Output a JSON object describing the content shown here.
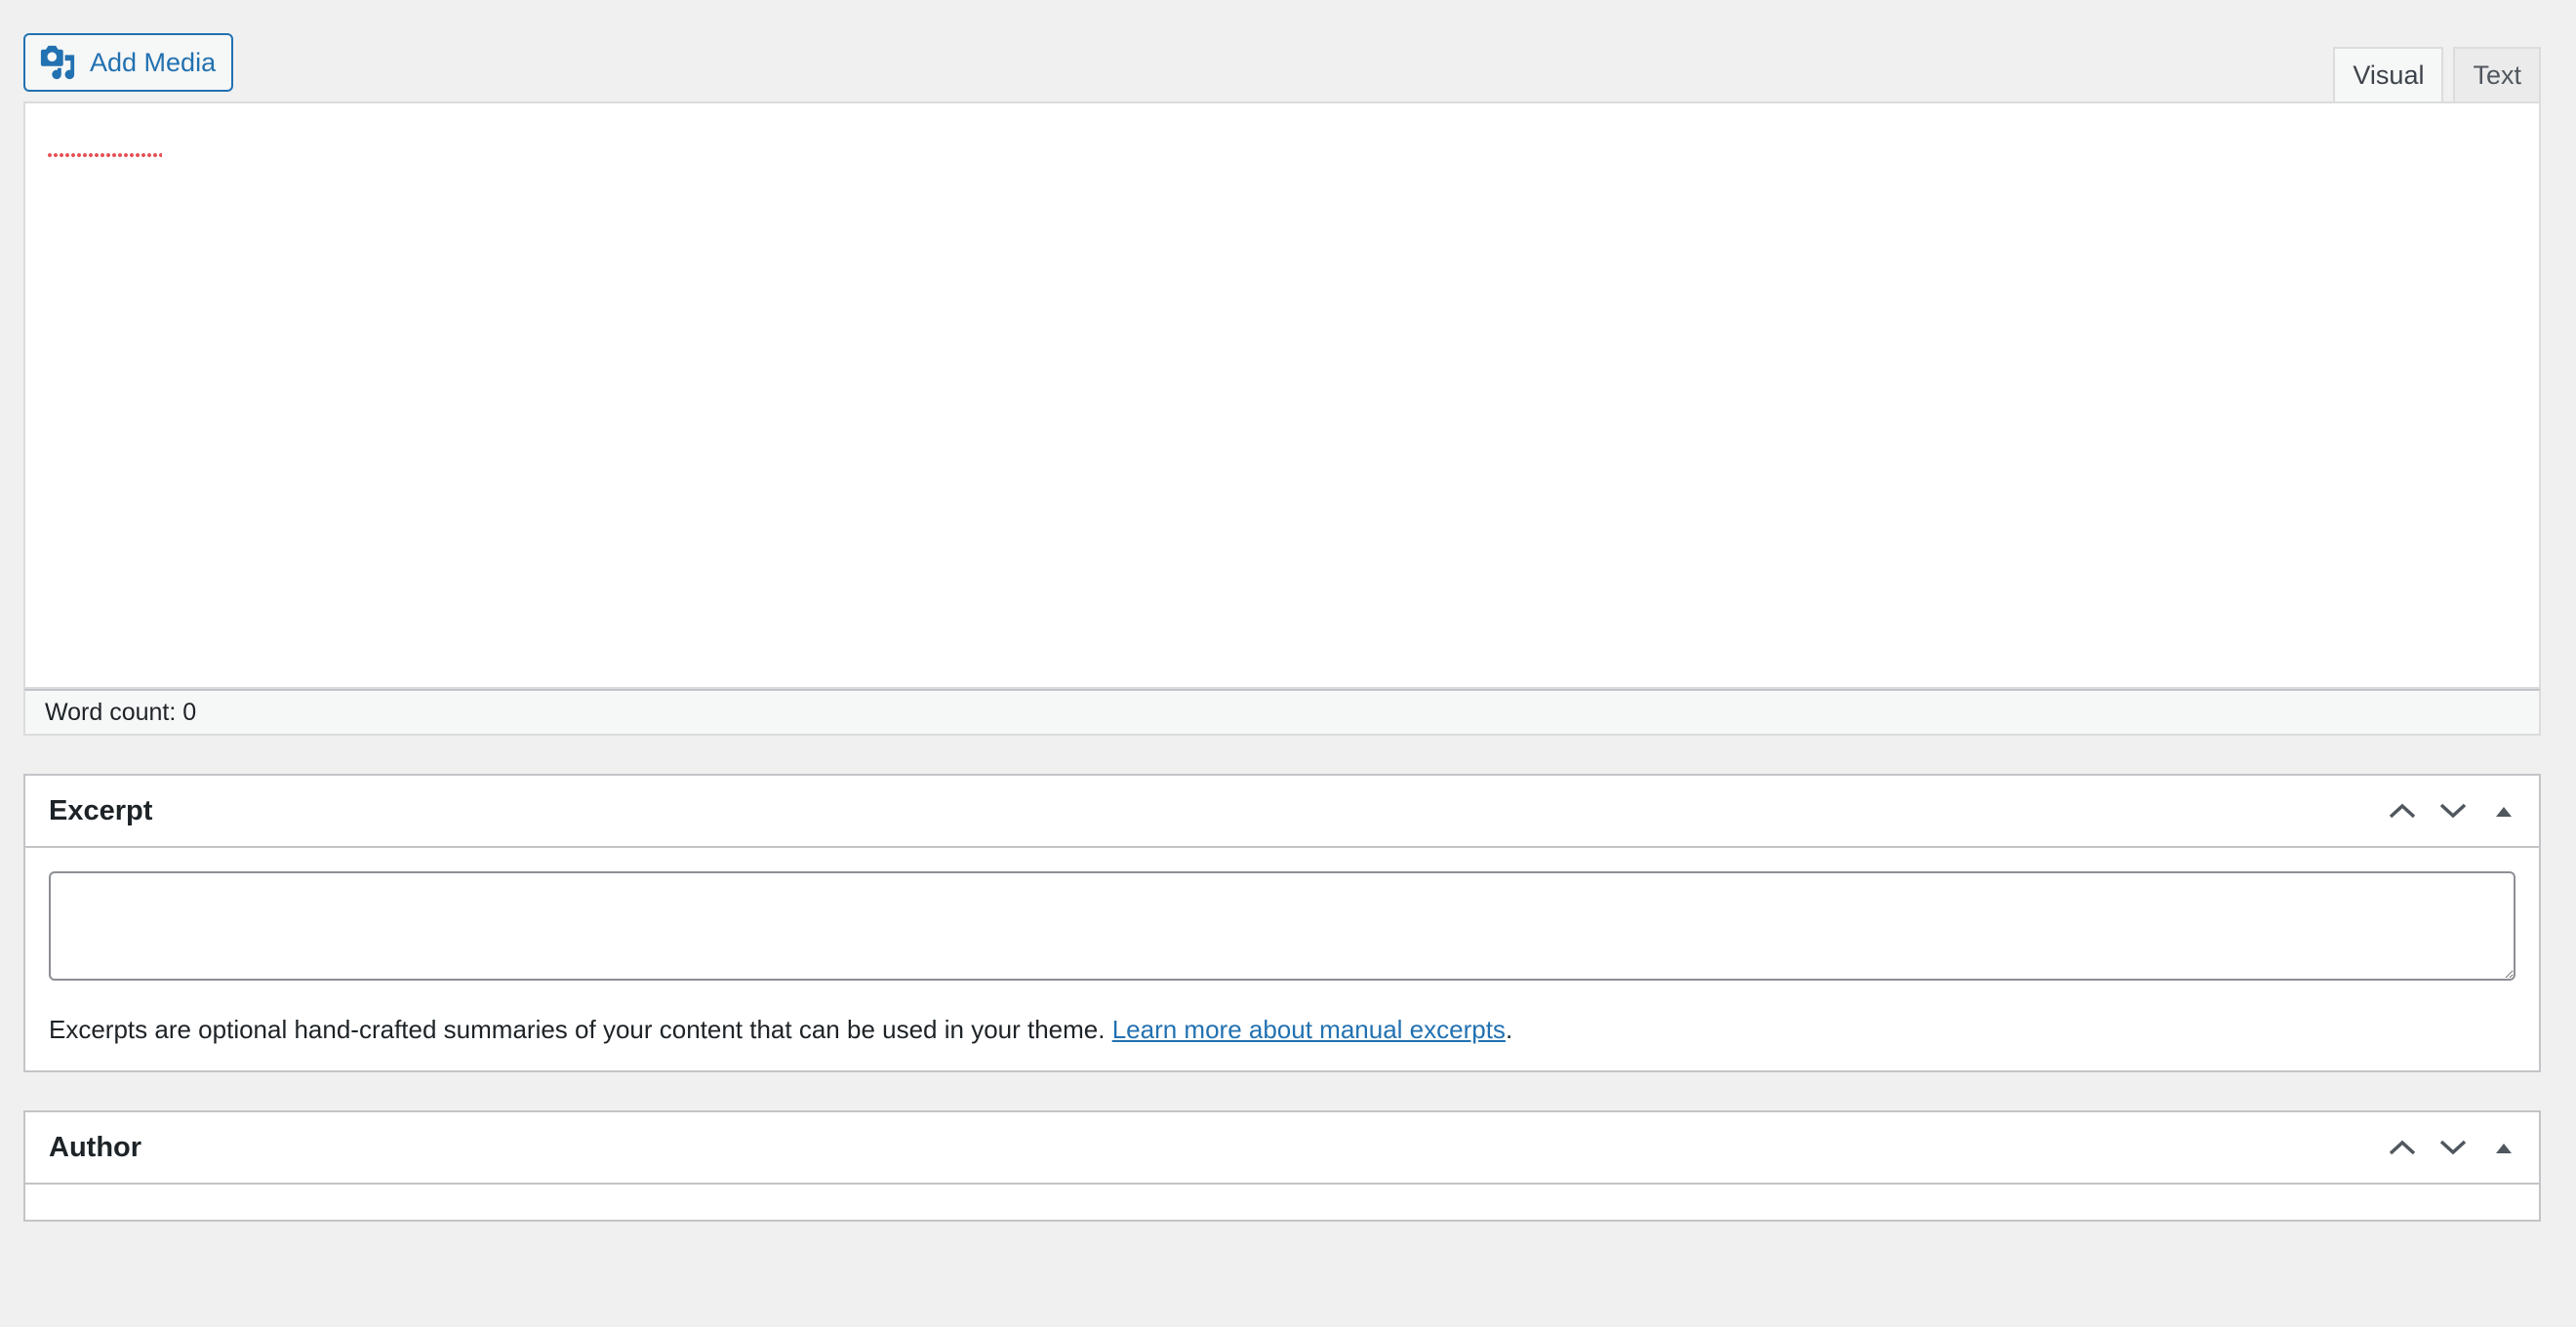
{
  "editor": {
    "add_media_label": "Add Media",
    "tabs": [
      {
        "label": "Visual",
        "active": true
      },
      {
        "label": "Text",
        "active": false
      }
    ],
    "word_count": "Word count: 0"
  },
  "excerpt": {
    "title": "Excerpt",
    "textarea_value": "",
    "help_text": "Excerpts are optional hand-crafted summaries of your content that can be used in your theme. ",
    "help_link": "Learn more about manual excerpts",
    "help_suffix": "."
  },
  "author": {
    "title": "Author"
  },
  "colors": {
    "accent": "#2271b1",
    "spellcheck": "#e65054",
    "background": "#f0f0f1"
  },
  "icons": {
    "add_media": "media-icon",
    "move_up": "chevron-up-icon",
    "move_down": "chevron-down-icon",
    "toggle": "triangle-up-icon"
  }
}
